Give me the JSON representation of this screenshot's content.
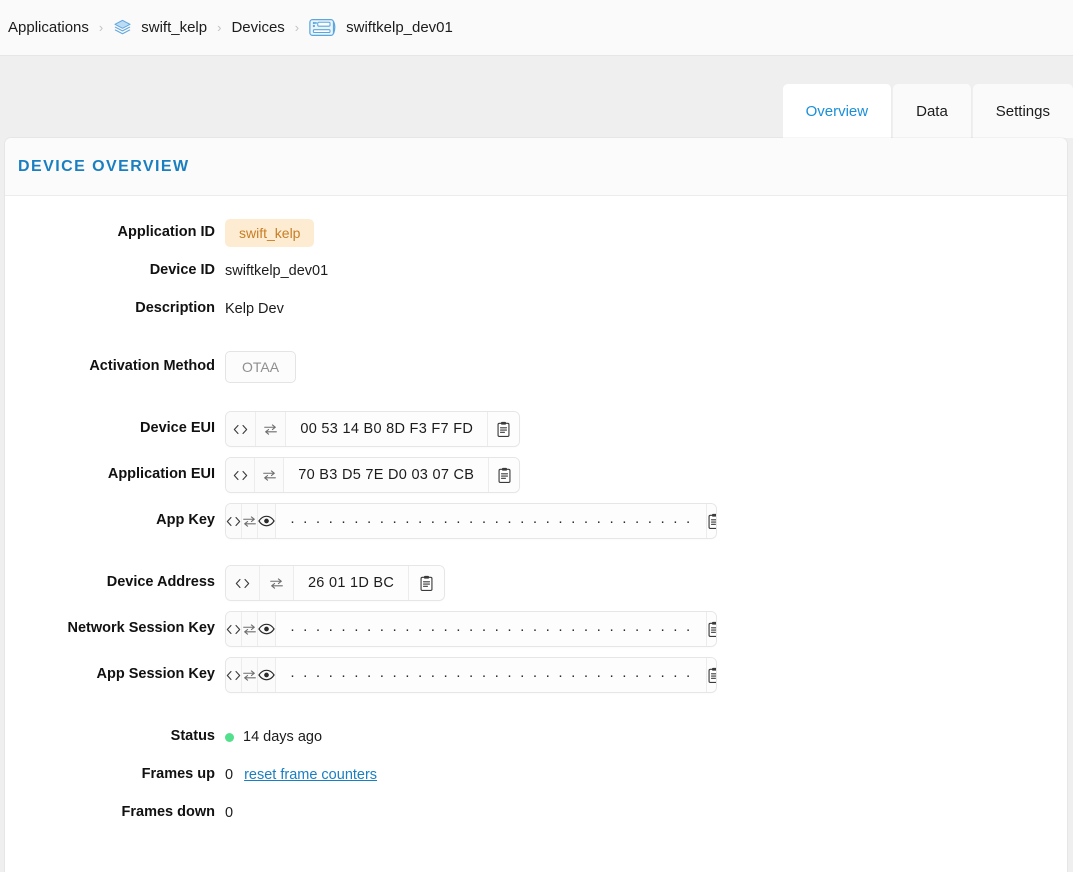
{
  "breadcrumb": {
    "items": [
      {
        "label": "Applications",
        "icon": null
      },
      {
        "label": "swift_kelp",
        "icon": "layers-stack-icon"
      },
      {
        "label": "Devices",
        "icon": null
      },
      {
        "label": "swiftkelp_dev01",
        "icon": "device-card-icon"
      }
    ],
    "separator": "›"
  },
  "tabs": [
    {
      "label": "Overview",
      "active": true
    },
    {
      "label": "Data",
      "active": false
    },
    {
      "label": "Settings",
      "active": false
    }
  ],
  "card": {
    "title": "Device Overview"
  },
  "fields": {
    "application_id_label": "Application ID",
    "application_id_value": "swift_kelp",
    "device_id_label": "Device ID",
    "device_id_value": "swiftkelp_dev01",
    "description_label": "Description",
    "description_value": "Kelp Dev",
    "activation_method_label": "Activation Method",
    "activation_method_value": "OTAA",
    "device_eui_label": "Device EUI",
    "device_eui_value": "00 53 14 B0 8D F3 F7 FD",
    "application_eui_label": "Application EUI",
    "application_eui_value": "70 B3 D5 7E D0 03 07 CB",
    "app_key_label": "App Key",
    "app_key_value": "· · · · · · · · · · · · · · · · · · · · · · · · · · · · · · · ·",
    "device_address_label": "Device Address",
    "device_address_value": "26 01 1D BC",
    "network_session_key_label": "Network Session Key",
    "network_session_key_value": "· · · · · · · · · · · · · · · · · · · · · · · · · · · · · · · ·",
    "app_session_key_label": "App Session Key",
    "app_session_key_value": "· · · · · · · · · · · · · · · · · · · · · · · · · · · · · · · ·",
    "status_label": "Status",
    "status_value": "14 days ago",
    "frames_up_label": "Frames up",
    "frames_up_value": "0",
    "reset_frame_counters_label": "reset frame counters",
    "frames_down_label": "Frames down",
    "frames_down_value": "0"
  },
  "colors": {
    "accent_blue": "#1a8fd8",
    "title_blue": "#1a7fc1",
    "badge_bg": "#fdecd2",
    "badge_text": "#c87d23",
    "status_green": "#52e08c",
    "page_bg": "#efefef"
  }
}
